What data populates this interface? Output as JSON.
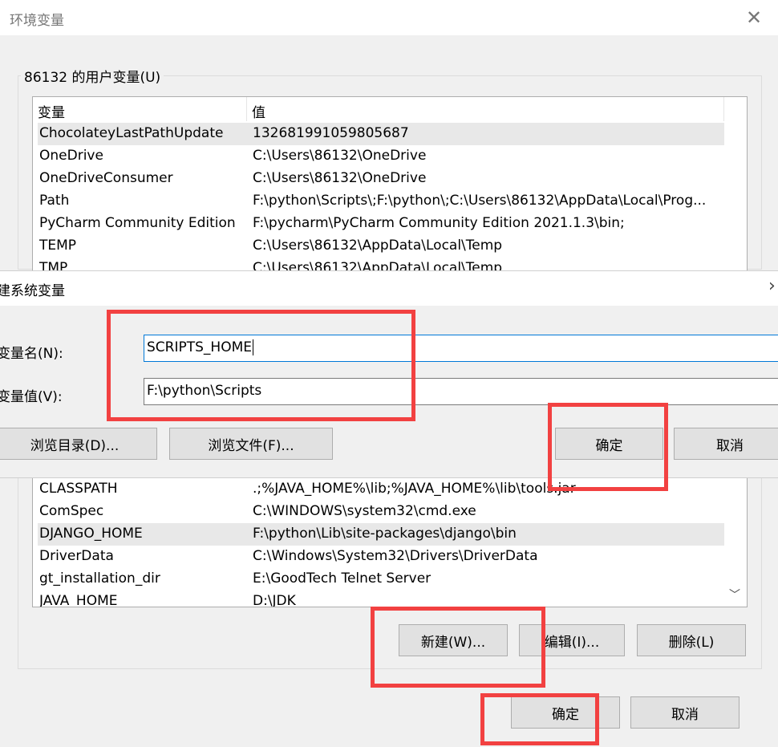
{
  "window": {
    "title": "环境变量"
  },
  "user_vars": {
    "group_label": "86132 的用户变量(U)",
    "columns": [
      "变量",
      "值"
    ],
    "rows": [
      {
        "name": "ChocolateyLastPathUpdate",
        "value": "132681991059805687"
      },
      {
        "name": "OneDrive",
        "value": "C:\\Users\\86132\\OneDrive"
      },
      {
        "name": "OneDriveConsumer",
        "value": "C:\\Users\\86132\\OneDrive"
      },
      {
        "name": "Path",
        "value": "F:\\python\\Scripts\\;F:\\python\\;C:\\Users\\86132\\AppData\\Local\\Prog..."
      },
      {
        "name": "PyCharm Community Edition",
        "value": "F:\\pycharm\\PyCharm Community Edition 2021.1.3\\bin;"
      },
      {
        "name": "TEMP",
        "value": "C:\\Users\\86132\\AppData\\Local\\Temp"
      },
      {
        "name": "TMP",
        "value": "C:\\Users\\86132\\AppData\\Local\\Temp"
      }
    ]
  },
  "dialog": {
    "title": "建系统变量",
    "name_label": "变量名(N):",
    "name_value": "SCRIPTS_HOME",
    "value_label": "变量值(V):",
    "value_value": "F:\\python\\Scripts",
    "browse_dir": "浏览目录(D)...",
    "browse_file": "浏览文件(F)...",
    "ok": "确定",
    "cancel": "取消"
  },
  "system_vars": {
    "rows": [
      {
        "name": "CLASSPATH",
        "value": ".;%JAVA_HOME%\\lib;%JAVA_HOME%\\lib\\tools.jar"
      },
      {
        "name": "ComSpec",
        "value": "C:\\WINDOWS\\system32\\cmd.exe"
      },
      {
        "name": "DJANGO_HOME",
        "value": "F:\\python\\Lib\\site-packages\\django\\bin"
      },
      {
        "name": "DriverData",
        "value": "C:\\Windows\\System32\\Drivers\\DriverData"
      },
      {
        "name": "gt_installation_dir",
        "value": "E:\\GoodTech Telnet Server"
      },
      {
        "name": "JAVA_HOME",
        "value": "D:\\JDK"
      }
    ],
    "new": "新建(W)...",
    "edit": "编辑(I)...",
    "delete": "删除(L)"
  },
  "footer": {
    "ok": "确定",
    "cancel": "取消"
  },
  "colors": {
    "highlight": "#f24141",
    "focus_border": "#0078d7"
  }
}
